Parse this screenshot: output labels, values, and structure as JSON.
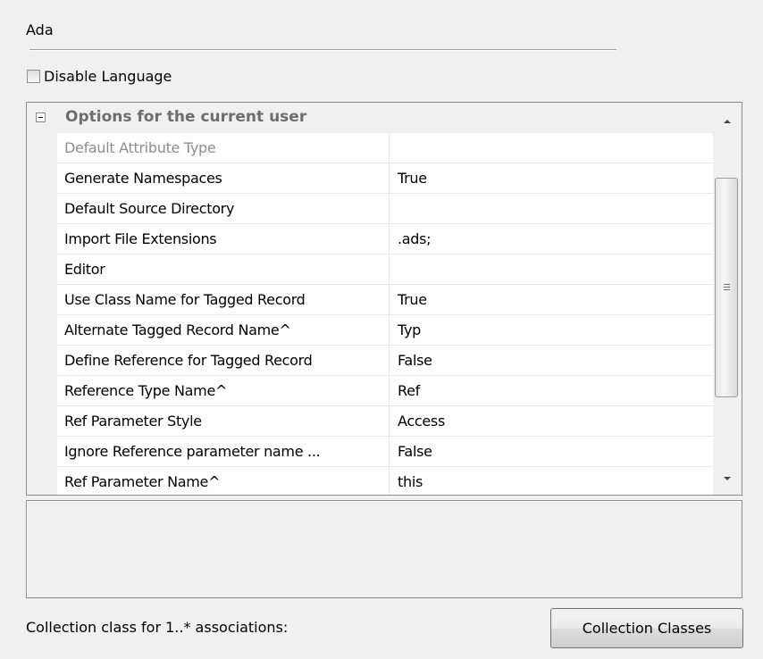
{
  "section": {
    "title": "Ada"
  },
  "disable_language": {
    "label": "Disable Language",
    "checked": false
  },
  "property_grid": {
    "category": "Options for the current user",
    "rows": [
      {
        "name": "Default Attribute Type",
        "value": "",
        "disabled": true
      },
      {
        "name": "Generate Namespaces",
        "value": "True"
      },
      {
        "name": "Default Source Directory",
        "value": ""
      },
      {
        "name": "Import File Extensions",
        "value": ".ads;"
      },
      {
        "name": "Editor",
        "value": ""
      },
      {
        "name": "Use Class Name for Tagged Record",
        "value": "True"
      },
      {
        "name": "Alternate Tagged Record Name^",
        "value": "Typ"
      },
      {
        "name": "Define Reference for Tagged Record",
        "value": "False"
      },
      {
        "name": "Reference Type Name^",
        "value": "Ref"
      },
      {
        "name": "Ref Parameter Style",
        "value": "Access"
      },
      {
        "name": "Ignore Reference parameter name ...",
        "value": "False"
      },
      {
        "name": "Ref Parameter Name^",
        "value": "this"
      }
    ]
  },
  "footer": {
    "label": "Collection class for 1..* associations:",
    "button_label": "Collection Classes"
  }
}
